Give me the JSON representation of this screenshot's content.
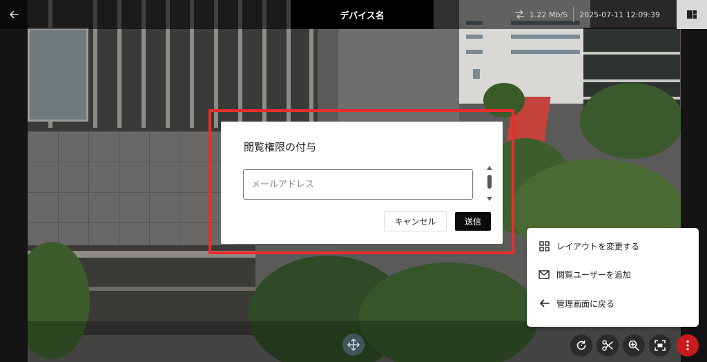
{
  "header": {
    "device_name": "デバイス名",
    "bitrate": "1.22 Mb/S",
    "datetime": "2025-07-11 12:09:39"
  },
  "dialog": {
    "title": "閲覧権限の付与",
    "email_placeholder": "メールアドレス",
    "email_value": "",
    "cancel_label": "キャンセル",
    "send_label": "送信"
  },
  "menu": {
    "items": [
      {
        "label": "レイアウトを変更する",
        "icon": "grid-icon"
      },
      {
        "label": "閲覧ユーザーを追加",
        "icon": "mail-icon"
      },
      {
        "label": "管理画面に戻る",
        "icon": "arrow-left-icon"
      }
    ]
  },
  "controls": [
    "refresh-icon",
    "scissors-icon",
    "zoom-in-icon",
    "fullscreen-icon",
    "more-vertical-icon"
  ],
  "colors": {
    "highlight": "#ee2b2b",
    "send_button": "#0b0b0b",
    "more_button": "#c81b1b"
  }
}
